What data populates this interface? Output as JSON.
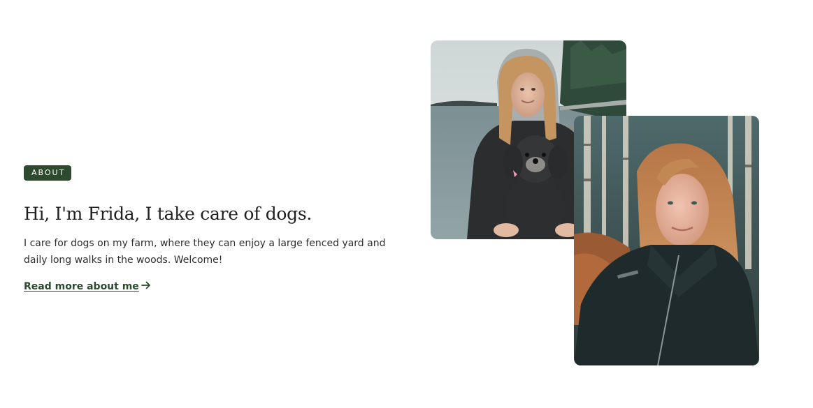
{
  "about": {
    "badge": "ABOUT",
    "headline": "Hi, I'm Frida, I take care of dogs.",
    "intro": "I care for dogs on my farm, where they can enjoy a large fenced yard and daily long walks in the woods. Welcome!",
    "read_more": "Read more about me",
    "read_more_icon": "arrow-right-icon"
  },
  "colors": {
    "accent": "#2d4a2f",
    "text": "#2e2e2e",
    "background": "#ffffff"
  },
  "photos": [
    {
      "description_icon": "photo-woman-with-dog-on-pier"
    },
    {
      "description_icon": "photo-woman-in-forest"
    }
  ]
}
